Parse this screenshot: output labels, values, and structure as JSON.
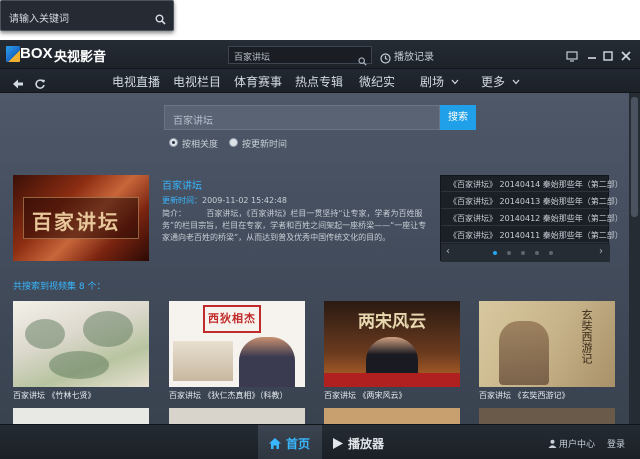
{
  "float_search": {
    "placeholder": "请输入关键词"
  },
  "app": {
    "logo_text": "BOX",
    "logo_cn": "央视影音",
    "top_search_value": "百家讲坛",
    "history_label": "播放记录"
  },
  "nav": {
    "items": [
      "电视直播",
      "电视栏目",
      "体育赛事",
      "热点专辑",
      "微纪实",
      "剧场",
      "更多"
    ]
  },
  "search": {
    "value": "百家讲坛",
    "button": "搜索",
    "sort_relevance": "按相关度",
    "sort_time": "按更新时间"
  },
  "featured": {
    "title": "百家讲坛",
    "time_label": "更新时间：",
    "time_value": "2009-11-02 15:42:48",
    "desc_label": "简介：",
    "desc": "百家讲坛，《百家讲坛》栏目一贯坚持“让专家，学者为百姓服务”的栏目宗旨，栏目在专家，学者和百姓之间架起一座桥梁——“一座让专家通向老百姓的桥梁”，从而达到普及优秀中国传统文化的目的。",
    "image_text": "百家讲坛"
  },
  "episodes": [
    "《百家讲坛》 20140414 秦始那些年（第二部）",
    "《百家讲坛》 20140413 秦始那些年（第二部）",
    "《百家讲坛》 20140412 秦始那些年（第二部）",
    "《百家讲坛》 20140411 秦始那些年（第二部）"
  ],
  "results": {
    "label": "共搜索到视频集 8 个：",
    "items": [
      {
        "caption": "百家讲坛 《竹林七贤》"
      },
      {
        "caption": "百家讲坛 《狄仁杰真相》（科教）",
        "art_text": "西狄相杰"
      },
      {
        "caption": "百家讲坛 《两宋风云》",
        "art_text": "两宋风云"
      },
      {
        "caption": "百家讲坛 《玄奘西游记》",
        "art_text": "玄奘西游记"
      }
    ]
  },
  "bottom": {
    "home": "首页",
    "player": "播放器",
    "user_center": "用户中心",
    "login": "登录"
  },
  "colors": {
    "accent": "#38b7ff",
    "button": "#1fa0e8",
    "bg": "#2f3640"
  }
}
